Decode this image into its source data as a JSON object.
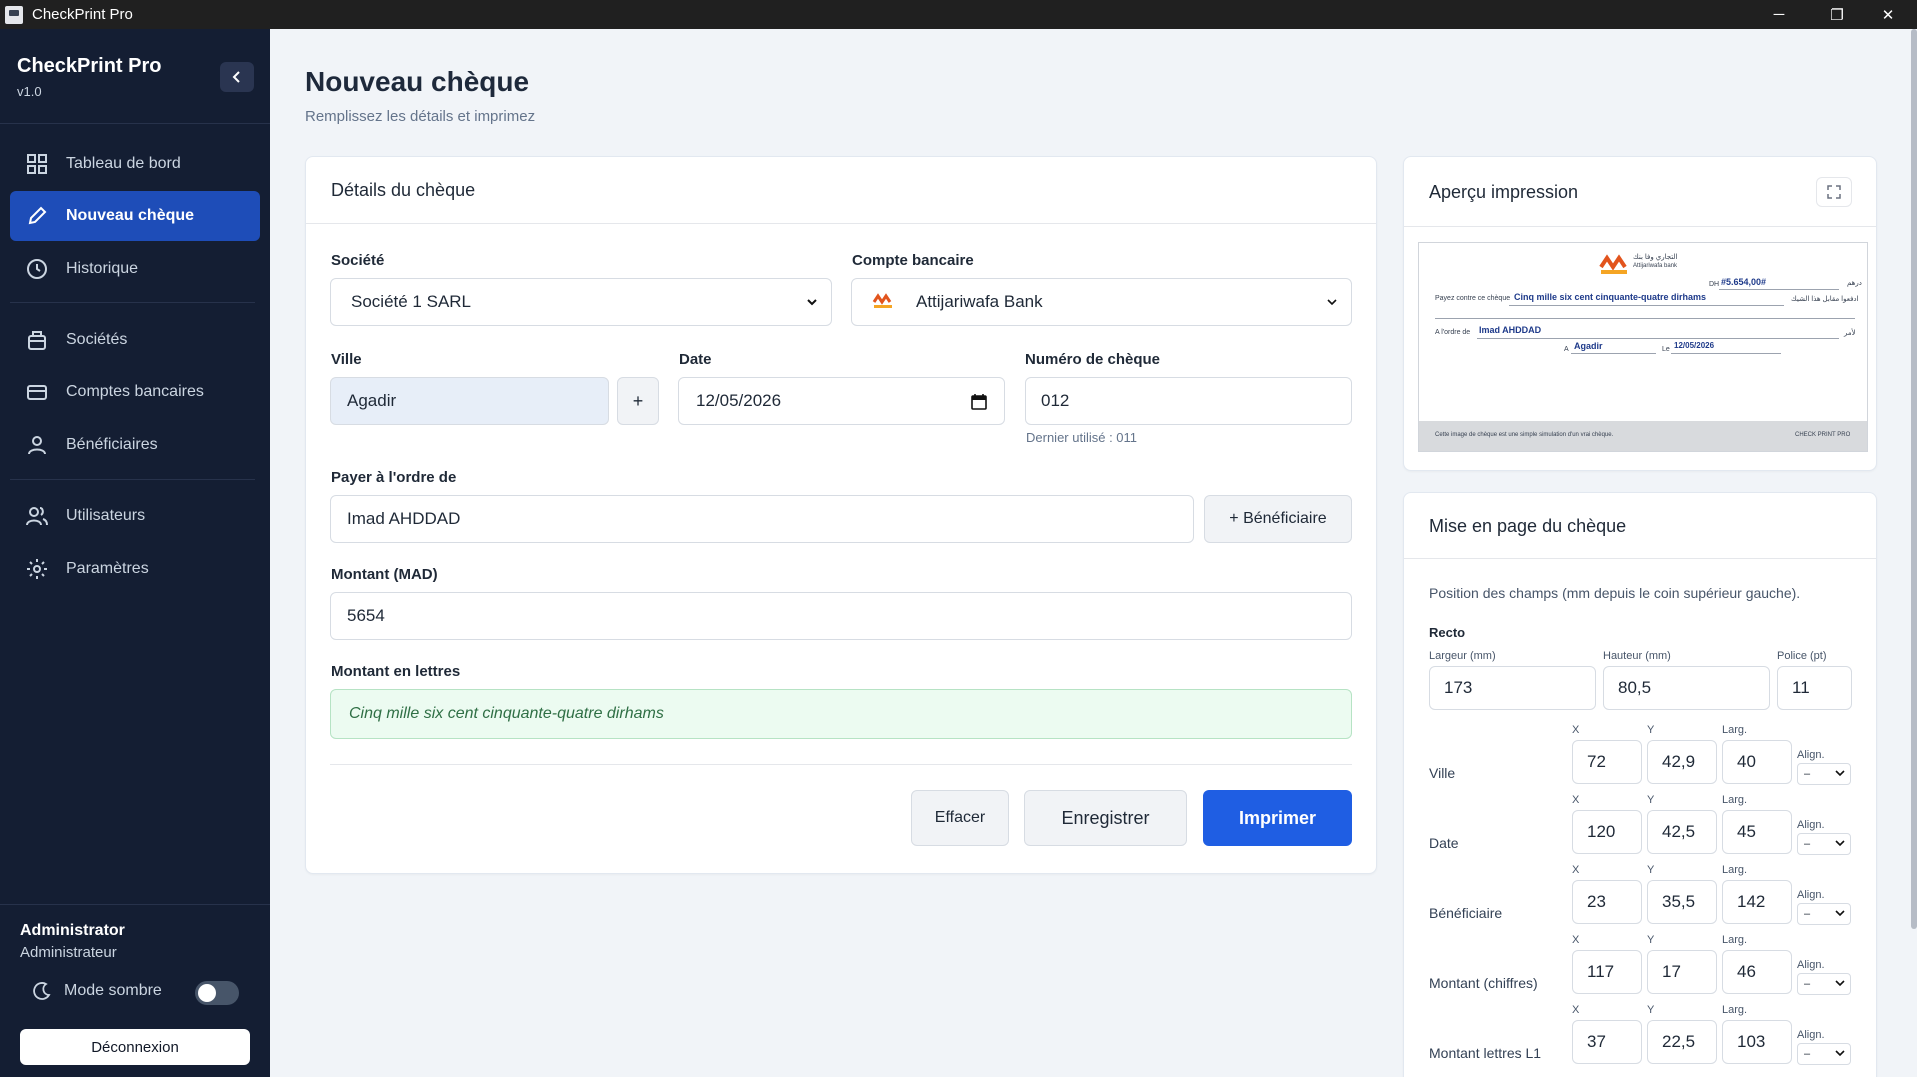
{
  "window": {
    "title": "CheckPrint Pro",
    "min": "─",
    "max": "❐",
    "close": "✕"
  },
  "sidebar": {
    "brand": "CheckPrint Pro",
    "version": "v1.0",
    "items": [
      {
        "label": "Tableau de bord",
        "icon": "dashboard-icon"
      },
      {
        "label": "Nouveau chèque",
        "icon": "pencil-icon",
        "active": true
      },
      {
        "label": "Historique",
        "icon": "clock-icon"
      },
      {
        "label": "Sociétés",
        "icon": "building-icon"
      },
      {
        "label": "Comptes bancaires",
        "icon": "card-icon"
      },
      {
        "label": "Bénéficiaires",
        "icon": "user-icon"
      },
      {
        "label": "Utilisateurs",
        "icon": "users-icon"
      },
      {
        "label": "Paramètres",
        "icon": "gear-icon"
      }
    ],
    "user_name": "Administrator",
    "user_role": "Administrateur",
    "dark_mode_label": "Mode sombre",
    "logout_label": "Déconnexion"
  },
  "header": {
    "title": "Nouveau chèque",
    "subtitle": "Remplissez les détails et imprimez"
  },
  "form": {
    "card_title": "Détails du chèque",
    "company_label": "Société",
    "company_value": "Société 1 SARL",
    "bank_label": "Compte bancaire",
    "bank_value": "Attijariwafa Bank",
    "city_label": "Ville",
    "city_value": "Agadir",
    "city_add": "+",
    "date_label": "Date",
    "date_value": "12/05/2026",
    "number_label": "Numéro de chèque",
    "number_value": "012",
    "number_hint": "Dernier utilisé : 011",
    "payee_label": "Payer à l'ordre de",
    "payee_value": "Imad AHDDAD",
    "add_beneficiary": "+ Bénéficiaire",
    "amount_label": "Montant (MAD)",
    "amount_value": "5654",
    "words_label": "Montant en lettres",
    "words_value": "Cinq mille six cent cinquante-quatre dirhams",
    "clear_label": "Effacer",
    "save_label": "Enregistrer",
    "print_label": "Imprimer"
  },
  "preview": {
    "title": "Aperçu impression",
    "cheque": {
      "bank_ar": "التجاري وفا بنك",
      "bank_fr": "Attijariwafa bank",
      "dh": "DH",
      "dirham_ar": "درهم",
      "amount": "#5.654,00#",
      "pay_label": "Payez contre ce chèque",
      "pay_ar": "ادفعوا مقابل هذا الشيك",
      "words": "Cinq mille six cent cinquante-quatre dirhams",
      "order_label": "A l'ordre de",
      "order_ar": "لأمر",
      "payee": "Imad AHDDAD",
      "at_label": "A",
      "city": "Agadir",
      "le_label": "Le",
      "date": "12/05/2026",
      "footer_note": "Cette image de chèque est une simple simulation d'un vrai chèque.",
      "footer_brand": "CHECK PRINT PRO"
    }
  },
  "layout": {
    "title": "Mise en page du chèque",
    "description": "Position des champs (mm depuis le coin supérieur gauche).",
    "section": "Recto",
    "width_label": "Largeur (mm)",
    "width_value": "173",
    "height_label": "Hauteur (mm)",
    "height_value": "80,5",
    "font_label": "Police (pt)",
    "font_value": "11",
    "col_x": "X",
    "col_y": "Y",
    "col_w": "Larg.",
    "col_align": "Align.",
    "align_value": "–",
    "rows": [
      {
        "label": "Ville",
        "x": "72",
        "y": "42,9",
        "w": "40"
      },
      {
        "label": "Date",
        "x": "120",
        "y": "42,5",
        "w": "45"
      },
      {
        "label": "Bénéficiaire",
        "x": "23",
        "y": "35,5",
        "w": "142"
      },
      {
        "label": "Montant (chiffres)",
        "x": "117",
        "y": "17",
        "w": "46"
      },
      {
        "label": "Montant lettres L1",
        "x": "37",
        "y": "22,5",
        "w": "103"
      }
    ]
  },
  "colors": {
    "sidebar": "#141e33",
    "accent": "#1f5ee3",
    "words_bg": "#ecfbf1"
  }
}
